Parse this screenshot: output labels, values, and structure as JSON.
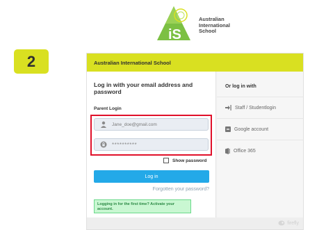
{
  "logo": {
    "mark_text": "iS",
    "name_line1": "Australian",
    "name_line2": "International",
    "name_line3": "School",
    "brand_green": "#7cc043"
  },
  "step": {
    "number": "2",
    "color": "#d9e021"
  },
  "window": {
    "header_title": "Australian International School",
    "login": {
      "title": "Log in with your email address and password",
      "subtitle": "Parent Login",
      "email_placeholder": "Jane_doe@gmail.com",
      "email_icon": "user-icon",
      "password_value": "**********",
      "password_icon": "lock-icon",
      "show_password_label": "Show password",
      "login_button": "Log in",
      "forgot_link": "Forgotten your password?",
      "first_time_message": "Logging in for the first time? Activate your account.",
      "highlight_color": "#e0102a",
      "button_color": "#23a9e8"
    },
    "alt_login": {
      "title": "Or log in with",
      "items": [
        {
          "label": "Staff / Studentlogin",
          "icon": "sign-in-icon"
        },
        {
          "label": "Google account",
          "icon": "google-icon"
        },
        {
          "label": "Office 365",
          "icon": "office-icon"
        }
      ]
    },
    "footer": {
      "brand": "firefly"
    }
  }
}
